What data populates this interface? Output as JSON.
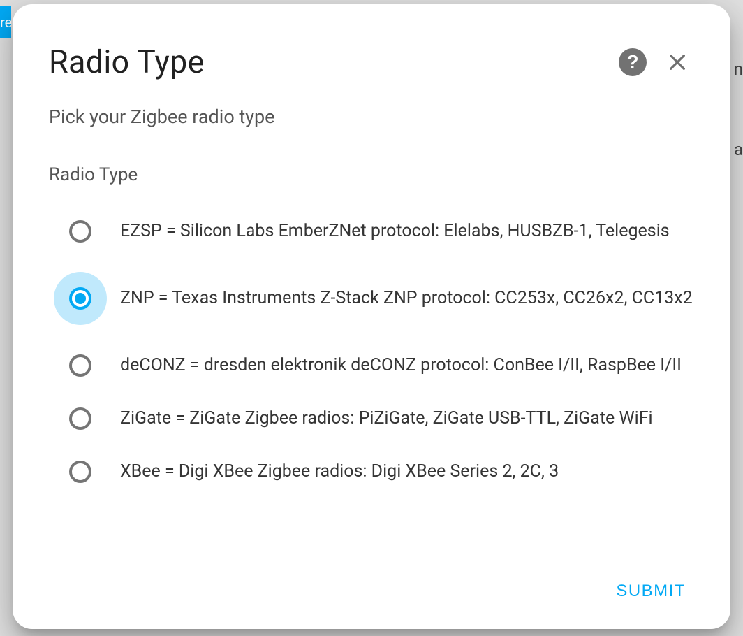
{
  "bg": {
    "tab_fragment": "re",
    "right_fragment_1": "n",
    "right_fragment_2": "a"
  },
  "dialog": {
    "title": "Radio Type",
    "subtitle": "Pick your Zigbee radio type",
    "section_label": "Radio Type",
    "submit_label": "SUBMIT",
    "selected_index": 1,
    "options": [
      {
        "id": "ezsp",
        "label": "EZSP = Silicon Labs EmberZNet protocol: Elelabs, HUSBZB-1, Telegesis"
      },
      {
        "id": "znp",
        "label": "ZNP = Texas Instruments Z-Stack ZNP protocol: CC253x, CC26x2, CC13x2"
      },
      {
        "id": "deconz",
        "label": "deCONZ = dresden elektronik deCONZ protocol: ConBee I/II, RaspBee I/II"
      },
      {
        "id": "zigate",
        "label": "ZiGate = ZiGate Zigbee radios: PiZiGate, ZiGate USB-TTL, ZiGate WiFi"
      },
      {
        "id": "xbee",
        "label": "XBee = Digi XBee Zigbee radios: Digi XBee Series 2, 2C, 3"
      }
    ]
  },
  "icons": {
    "help": "help-icon",
    "close": "close-icon"
  },
  "colors": {
    "accent": "#03a9f4",
    "radio_unchecked": "#757575",
    "text_primary": "#212121",
    "text_secondary": "#555555"
  }
}
